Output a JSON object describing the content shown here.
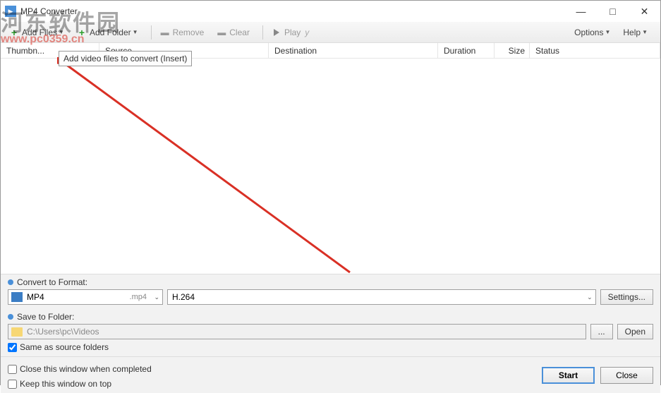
{
  "titlebar": {
    "title": "MP4 Converter"
  },
  "toolbar": {
    "add_files": "Add Files",
    "add_folder": "Add Folder",
    "remove": "Remove",
    "clear": "Clear",
    "play": "Play",
    "play_suffix": "y",
    "options": "Options",
    "help": "Help"
  },
  "tooltip": {
    "text": "Add video files to convert (Insert)"
  },
  "columns": {
    "thumbnail": "Thumbn...",
    "source": "Source",
    "destination": "Destination",
    "duration": "Duration",
    "size": "Size",
    "status": "Status"
  },
  "convert": {
    "label": "Convert to Format:",
    "format": "MP4",
    "ext": ".mp4",
    "codec": "H.264",
    "settings_btn": "Settings..."
  },
  "save": {
    "label": "Save to Folder:",
    "path": "C:\\Users\\pc\\Videos",
    "browse": "...",
    "open": "Open",
    "same_as_source": "Same as source folders"
  },
  "footer": {
    "close_when_done": "Close this window when completed",
    "keep_on_top": "Keep this window on top",
    "start": "Start",
    "close": "Close"
  },
  "watermark": {
    "text": "河东软件园",
    "url": "www.pc0359.cn"
  }
}
